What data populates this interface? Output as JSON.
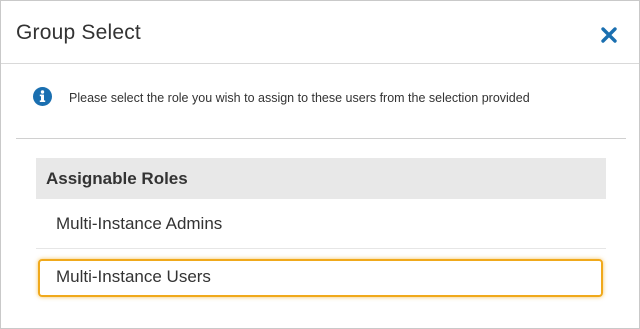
{
  "dialog": {
    "title": "Group Select",
    "close_icon": "close-icon",
    "accent_color": "#1a6fb0",
    "focus_color": "#f0a91b"
  },
  "info": {
    "icon": "info-icon",
    "message": "Please select the role you wish to assign to these users from the selection provided"
  },
  "roles": {
    "header": "Assignable Roles",
    "items": [
      {
        "label": "Multi-Instance Admins",
        "focused": false
      },
      {
        "label": "Multi-Instance Users",
        "focused": true
      }
    ]
  }
}
